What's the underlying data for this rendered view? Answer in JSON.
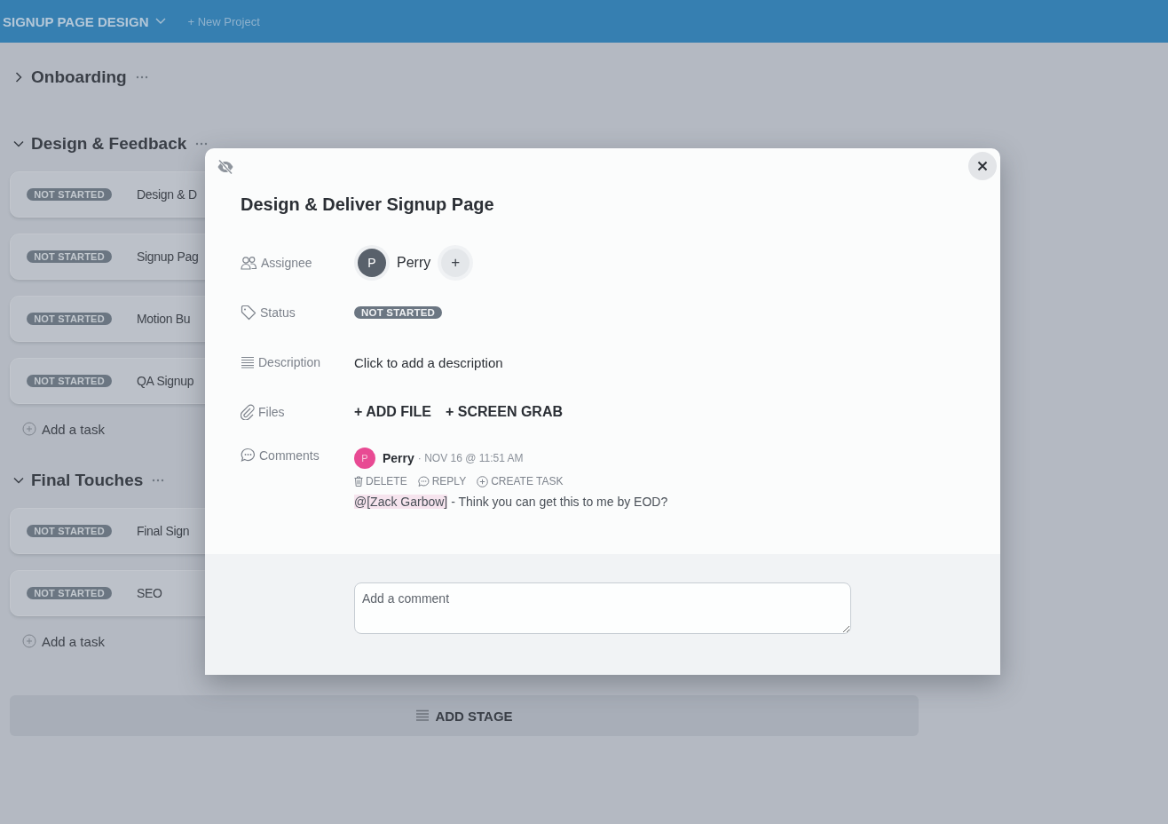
{
  "header": {
    "project": "SIGNUP PAGE DESIGN",
    "new_project": "+ New Project"
  },
  "stages": [
    {
      "title": "Onboarding",
      "expanded": false
    },
    {
      "title": "Design & Feedback",
      "expanded": true,
      "tasks": [
        {
          "status": "NOT STARTED",
          "title": "Design & D"
        },
        {
          "status": "NOT STARTED",
          "title": "Signup Pag"
        },
        {
          "status": "NOT STARTED",
          "title": "Motion Bu"
        },
        {
          "status": "NOT STARTED",
          "title": "QA Signup"
        }
      ],
      "add_task": "Add a task"
    },
    {
      "title": "Final Touches",
      "expanded": true,
      "tasks": [
        {
          "status": "NOT STARTED",
          "title": "Final Sign"
        },
        {
          "status": "NOT STARTED",
          "title": "SEO"
        }
      ],
      "add_task": "Add a task"
    }
  ],
  "add_stage": "ADD STAGE",
  "modal": {
    "title": "Design & Deliver Signup Page",
    "fields": [
      {
        "kind": "assignee",
        "label": "Assignee",
        "avatar": "P",
        "name": "Perry",
        "add": "+"
      },
      {
        "kind": "status",
        "label": "Status",
        "badge": "NOT STARTED"
      },
      {
        "kind": "description",
        "label": "Description",
        "value": "Click to add a description"
      },
      {
        "kind": "files",
        "label": "Files",
        "actions": [
          "+ ADD FILE",
          "+ SCREEN GRAB"
        ]
      },
      {
        "kind": "comments",
        "label": "Comments",
        "comments": [
          {
            "avatar": "P",
            "author": "Perry",
            "time": "· NOV 16 @ 11:51 AM",
            "actions": [
              {
                "kind": "delete",
                "label": "DELETE"
              },
              {
                "kind": "reply",
                "label": "REPLY"
              },
              {
                "kind": "create",
                "label": "CREATE TASK"
              }
            ],
            "mention": "@[Zack Garbow]",
            "text": " - Think you can get this to me by EOD?"
          }
        ]
      }
    ],
    "comment_placeholder": "Add a comment"
  }
}
